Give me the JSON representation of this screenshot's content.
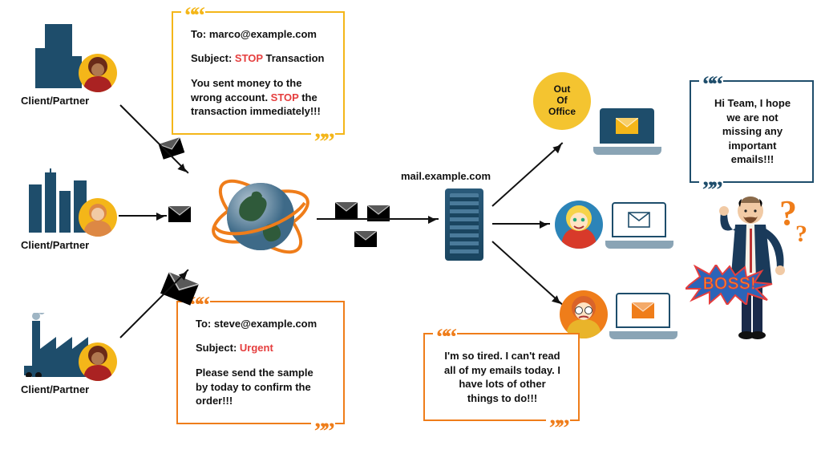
{
  "clients": [
    {
      "label": "Client/Partner"
    },
    {
      "label": "Client/Partner"
    },
    {
      "label": "Client/Partner"
    }
  ],
  "emails": {
    "yellow": {
      "to_label": "To:",
      "to": "marco@example.com",
      "subject_label": "Subject:",
      "subject_keyword": "STOP",
      "subject_rest": "Transaction",
      "body_pre": "You sent money to the wrong account. ",
      "body_keyword": "STOP",
      "body_post": " the transaction immediately!!!"
    },
    "orange": {
      "to_label": "To:",
      "to": "steve@example.com",
      "subject_label": "Subject:",
      "subject_keyword": "Urgent",
      "body": "Please send the sample by today to confirm the order!!!"
    }
  },
  "server": {
    "label": "mail.example.com"
  },
  "ooo": {
    "line1": "Out",
    "line2": "Of",
    "line3": "Office"
  },
  "tired_speech": "I'm so tired. I can't read all of my emails today. I have lots of other things to do!!!",
  "boss_speech": "Hi Team, I hope we are not missing any important emails!!!",
  "boss_burst": "BOSS!"
}
